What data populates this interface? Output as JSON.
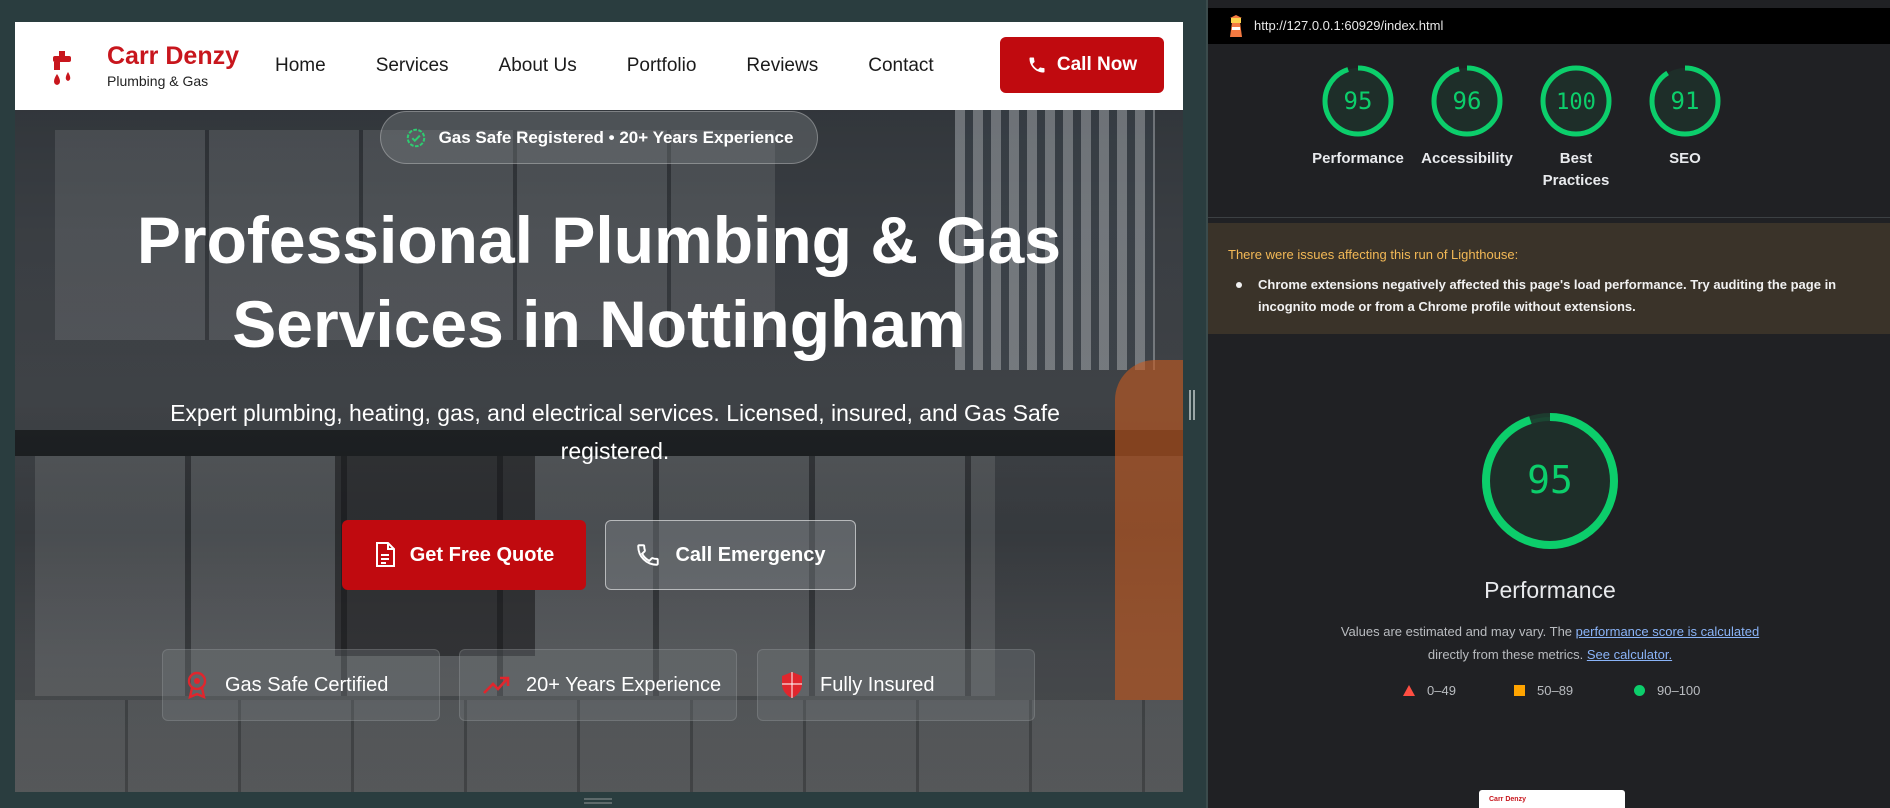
{
  "site": {
    "brand": {
      "name": "Carr Denzy",
      "tagline": "Plumbing & Gas"
    },
    "nav": {
      "links": [
        "Home",
        "Services",
        "About Us",
        "Portfolio",
        "Reviews",
        "Contact"
      ],
      "call_label": "Call Now"
    },
    "hero": {
      "badge": "Gas Safe Registered • 20+ Years Experience",
      "title_line1": "Professional Plumbing & Gas",
      "title_line2": "Services in Nottingham",
      "subtitle": "Expert plumbing, heating, gas, and electrical services. Licensed, insured, and Gas Safe registered.",
      "quote_label": "Get Free Quote",
      "emergency_label": "Call Emergency",
      "features": [
        "Gas Safe Certified",
        "20+ Years Experience",
        "Fully Insured"
      ]
    },
    "colors": {
      "brand_red": "#c00a0f",
      "white": "#ffffff"
    },
    "icons": {
      "logo": "tap-icon",
      "call": "phone-icon",
      "badge": "check-badge-icon",
      "quote": "document-icon",
      "feature1": "certified-badge-icon",
      "feature2": "trending-up-icon",
      "feature3": "shield-icon"
    }
  },
  "lighthouse": {
    "url": "http://127.0.0.1:60929/index.html",
    "scores": [
      {
        "label": "Performance",
        "value": 95
      },
      {
        "label": "Accessibility",
        "value": 96
      },
      {
        "label": "Best Practices",
        "value": 100
      },
      {
        "label": "SEO",
        "value": 91
      }
    ],
    "warning": {
      "title": "There were issues affecting this run of Lighthouse:",
      "item": "Chrome extensions negatively affected this page's load performance. Try auditing the page in incognito mode or from a Chrome profile without extensions."
    },
    "performance": {
      "score": 95,
      "title": "Performance",
      "desc_prefix": "Values are estimated and may vary. The ",
      "desc_link1": "performance score is calculated",
      "desc_mid": "directly from these metrics.",
      "desc_link2": "See calculator."
    },
    "legend": [
      "0–49",
      "50–89",
      "90–100"
    ],
    "thumbnail": {
      "brand": "Carr Denzy"
    },
    "colors": {
      "pass": "#0cce6b",
      "average": "#ffa400",
      "fail": "#ff4e42",
      "background": "#202124"
    }
  }
}
